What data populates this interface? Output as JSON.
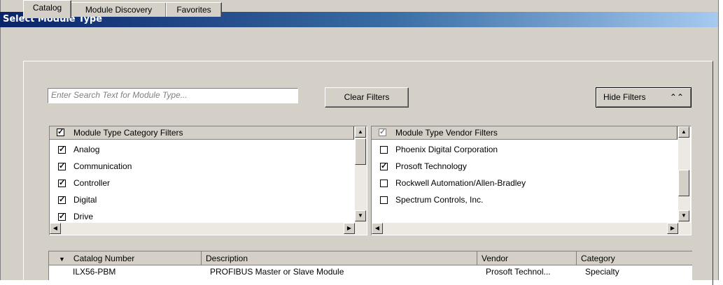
{
  "window": {
    "title": "Select Module Type"
  },
  "tabs": [
    {
      "label": "Catalog",
      "active": true
    },
    {
      "label": "Module Discovery",
      "active": false
    },
    {
      "label": "Favorites",
      "active": false
    }
  ],
  "search": {
    "placeholder": "Enter Search Text for Module Type..."
  },
  "buttons": {
    "clear_filters": "Clear Filters",
    "hide_filters": "Hide Filters",
    "hide_filters_icon": "double-chevron-up-icon"
  },
  "category_filters": {
    "header": "Module Type Category Filters",
    "header_checked": true,
    "items": [
      {
        "label": "Analog",
        "checked": true
      },
      {
        "label": "Communication",
        "checked": true
      },
      {
        "label": "Controller",
        "checked": true
      },
      {
        "label": "Digital",
        "checked": true
      },
      {
        "label": "Drive",
        "checked": true
      }
    ]
  },
  "vendor_filters": {
    "header": "Module Type Vendor Filters",
    "header_checked": true,
    "items": [
      {
        "label": "Phoenix Digital Corporation",
        "checked": false
      },
      {
        "label": "Prosoft Technology",
        "checked": true
      },
      {
        "label": "Rockwell Automation/Allen-Bradley",
        "checked": false
      },
      {
        "label": "Spectrum Controls, Inc.",
        "checked": false
      }
    ]
  },
  "results_table": {
    "columns": [
      "Catalog Number",
      "Description",
      "Vendor",
      "Category"
    ],
    "rows": [
      [
        "ILX56-PBM",
        "PROFIBUS Master or Slave Module",
        "Prosoft Technol...",
        "Specialty"
      ]
    ]
  }
}
